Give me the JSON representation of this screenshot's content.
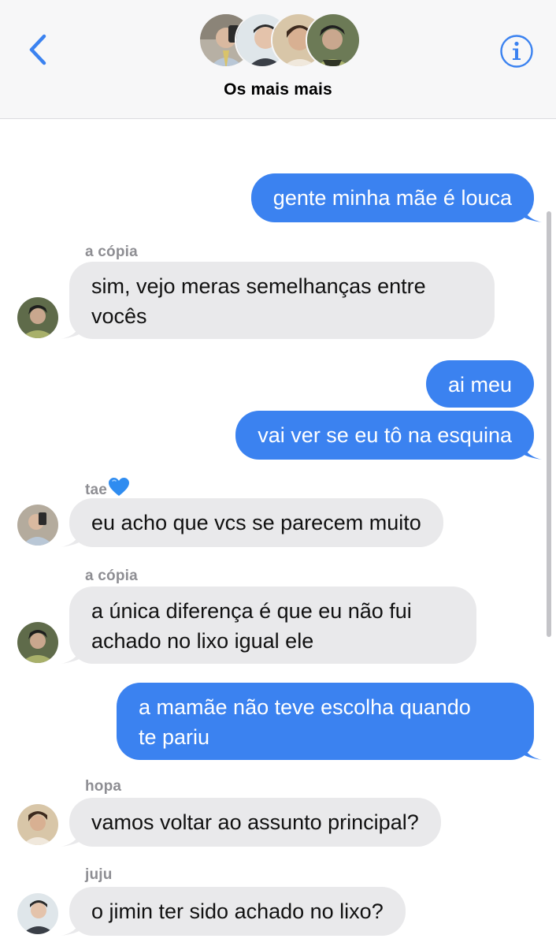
{
  "header": {
    "group_name": "Os mais mais",
    "back_icon": "chevron-left-icon",
    "info_icon": "info-circle-icon",
    "accent": "#3b82f0"
  },
  "messages": [
    {
      "direction": "outgoing",
      "text": "gente minha mãe é louca"
    },
    {
      "direction": "incoming",
      "sender": "a cópia",
      "line1": "sim, vejo meras semelhanças entre",
      "line2": "vocês"
    },
    {
      "direction": "outgoing",
      "text": "ai meu"
    },
    {
      "direction": "outgoing",
      "text": "vai ver se eu tô na esquina"
    },
    {
      "direction": "incoming",
      "sender": "tae",
      "sender_emoji": "blue-heart-icon",
      "text": "eu acho que vcs se parecem muito"
    },
    {
      "direction": "incoming",
      "sender": "a cópia",
      "line1": "a única diferença é que eu não fui",
      "line2": "achado no lixo igual ele"
    },
    {
      "direction": "outgoing",
      "line1": "a mamãe não teve escolha quando",
      "line2": "te pariu"
    },
    {
      "direction": "incoming",
      "sender": "hopa",
      "text": "vamos voltar ao assunto principal?"
    },
    {
      "direction": "incoming",
      "sender": "juju",
      "text": "o jimin ter sido achado no lixo?"
    }
  ],
  "colors": {
    "outgoing_bubble": "#3b82f0",
    "incoming_bubble": "#e9e9eb",
    "sender_label": "#8e8e93"
  }
}
